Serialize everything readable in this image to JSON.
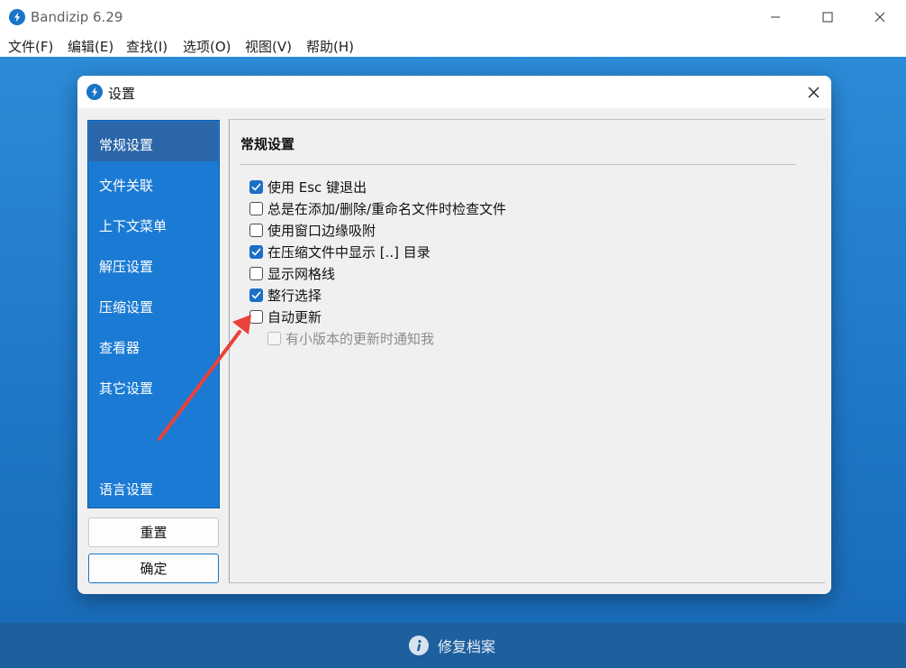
{
  "window": {
    "title": "Bandizip 6.29",
    "logo_icon": "bandizip-logo-icon",
    "controls": [
      "minimize-icon",
      "maximize-icon",
      "close-icon"
    ]
  },
  "menubar": {
    "items": [
      "文件(F)",
      "编辑(E)",
      "查找(I)",
      "选项(O)",
      "视图(V)",
      "帮助(H)"
    ]
  },
  "footer": {
    "repair_label": "修复档案",
    "icon": "info-icon"
  },
  "dialog": {
    "title": "设置",
    "nav": {
      "items": [
        "常规设置",
        "文件关联",
        "上下文菜单",
        "解压设置",
        "压缩设置",
        "查看器",
        "其它设置",
        "语言设置"
      ],
      "selected": "常规设置"
    },
    "buttons": {
      "reset": "重置",
      "ok": "确定"
    },
    "section": {
      "title": "常规设置",
      "options": [
        {
          "label": "使用 Esc 键退出",
          "checked": true
        },
        {
          "label": "总是在添加/删除/重命名文件时检查文件",
          "checked": false
        },
        {
          "label": "使用窗口边缘吸附",
          "checked": false
        },
        {
          "label": "在压缩文件中显示 [..] 目录",
          "checked": true
        },
        {
          "label": "显示网格线",
          "checked": false
        },
        {
          "label": "整行选择",
          "checked": true
        },
        {
          "label": "自动更新",
          "checked": false
        },
        {
          "label": "有小版本的更新时通知我",
          "checked": false,
          "disabled": true
        }
      ]
    }
  },
  "colors": {
    "accent": "#1b6fc4",
    "nav_background": "#1b7bd4",
    "nav_selected": "#2b67a8",
    "backdrop": "#2280cf",
    "footer": "#1e5f9e",
    "annotation_arrow": "#e8423b"
  }
}
